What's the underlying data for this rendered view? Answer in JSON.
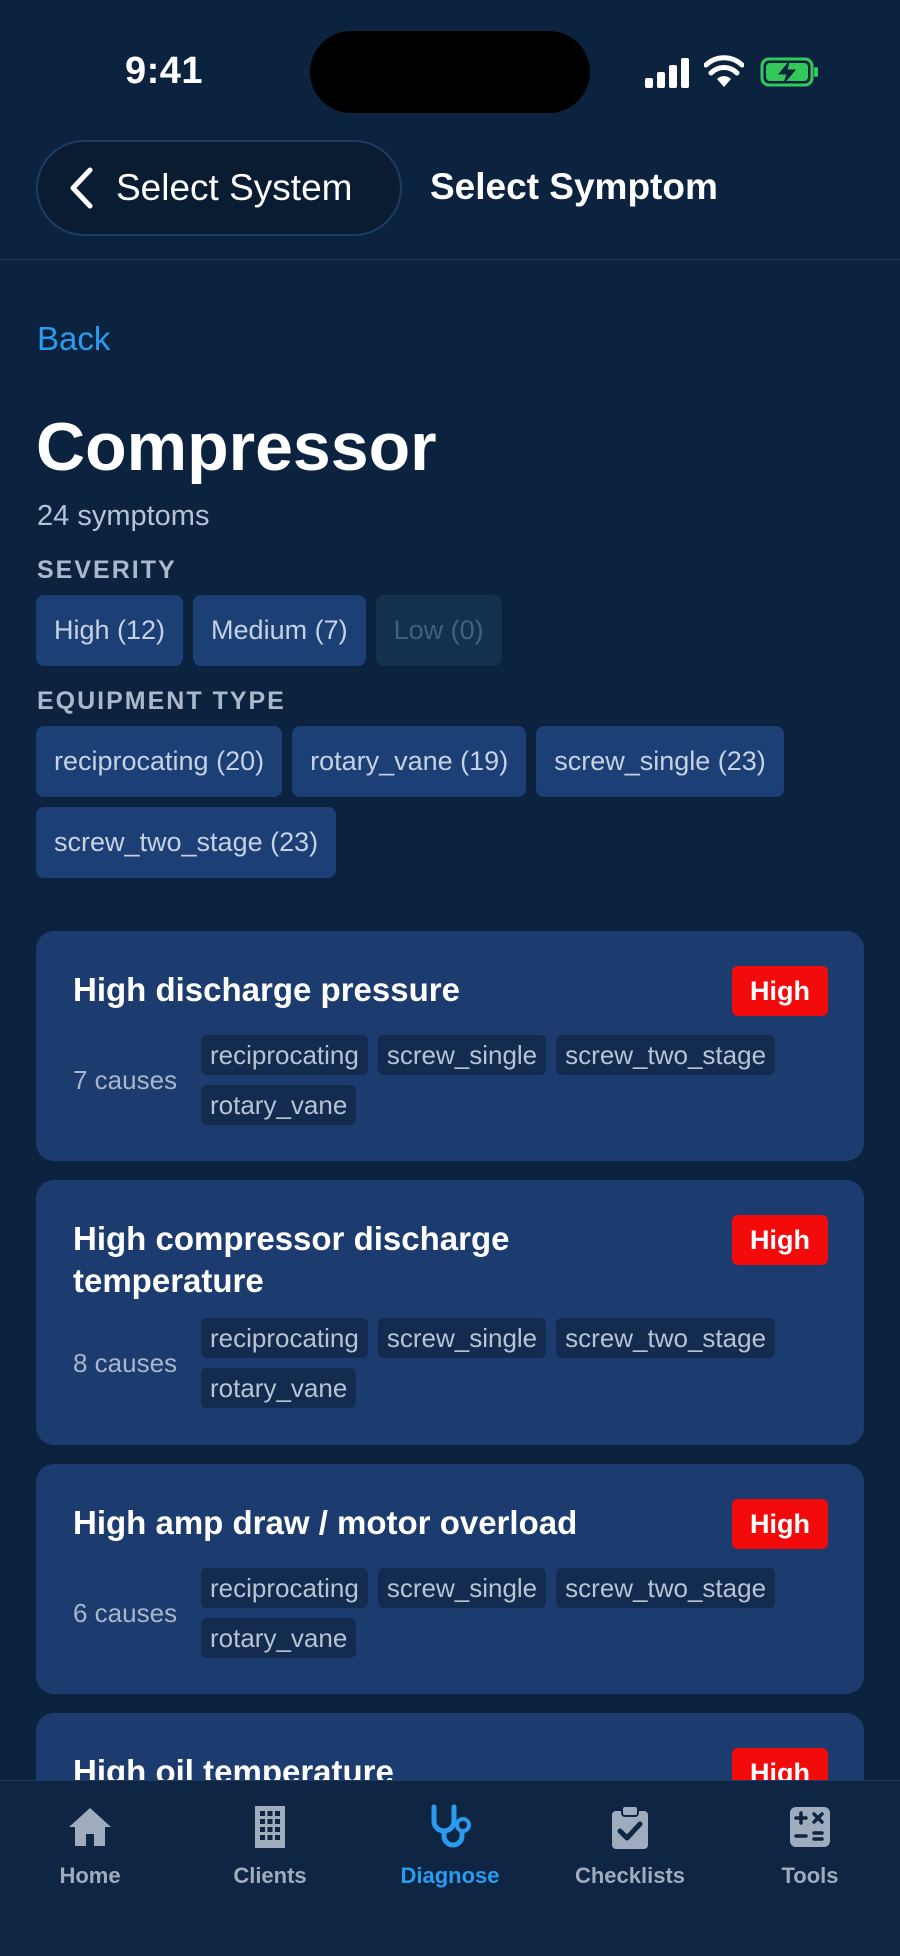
{
  "status_bar": {
    "time": "9:41"
  },
  "nav": {
    "back_label": "Select System",
    "title": "Select Symptom"
  },
  "content": {
    "back_link": "Back",
    "title": "Compressor",
    "symptom_count": "24 symptoms",
    "severity_label": "SEVERITY",
    "severity_filters": [
      "High (12)",
      "Medium (7)",
      "Low (0)"
    ],
    "equipment_label": "EQUIPMENT TYPE",
    "equipment_filters": [
      "reciprocating (20)",
      "rotary_vane (19)",
      "screw_single (23)",
      "screw_two_stage (23)"
    ]
  },
  "symptoms": [
    {
      "title": "High discharge pressure",
      "severity": "High",
      "causes": "7 causes",
      "tags": [
        "reciprocating",
        "screw_single",
        "screw_two_stage",
        "rotary_vane"
      ]
    },
    {
      "title": "High compressor discharge temperature",
      "severity": "High",
      "causes": "8 causes",
      "tags": [
        "reciprocating",
        "screw_single",
        "screw_two_stage",
        "rotary_vane"
      ]
    },
    {
      "title": "High amp draw / motor overload",
      "severity": "High",
      "causes": "6 causes",
      "tags": [
        "reciprocating",
        "screw_single",
        "screw_two_stage",
        "rotary_vane"
      ]
    },
    {
      "title": "High oil temperature",
      "severity": "High"
    }
  ],
  "tabs": [
    {
      "label": "Home",
      "icon": "house-icon"
    },
    {
      "label": "Clients",
      "icon": "building-icon"
    },
    {
      "label": "Diagnose",
      "icon": "stethoscope-icon",
      "active": true
    },
    {
      "label": "Checklists",
      "icon": "clipboard-check-icon"
    },
    {
      "label": "Tools",
      "icon": "calculator-icon"
    }
  ],
  "colors": {
    "background": "#0c2340",
    "accent": "#2b9bf0",
    "card": "#1c3b6e",
    "severity_high": "#f30b0b",
    "battery_charging": "#34c759"
  }
}
